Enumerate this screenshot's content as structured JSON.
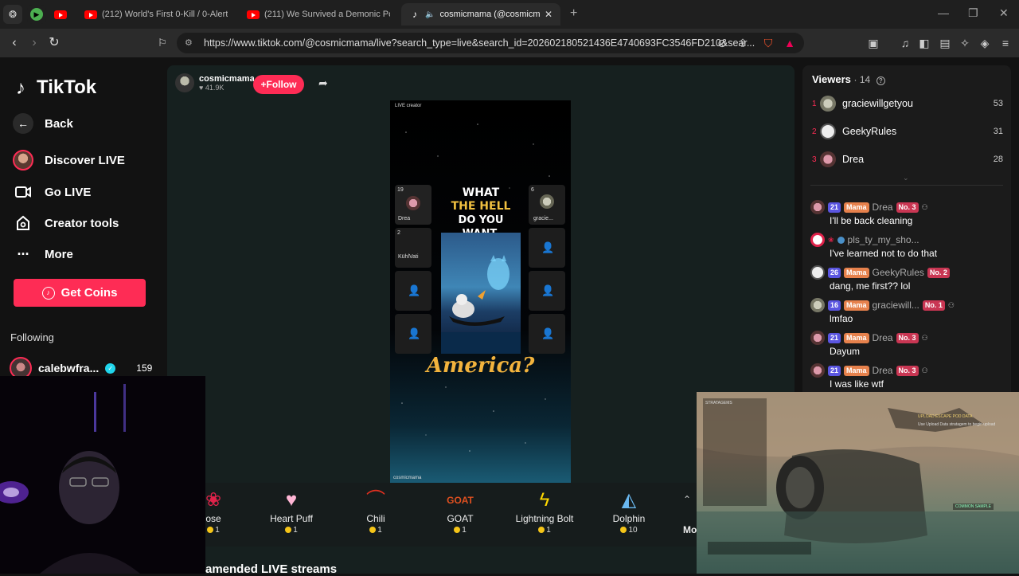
{
  "browser": {
    "tabs": [
      {
        "title": "(212) World's First 0-Kill / 0-Alert Ste"
      },
      {
        "title": "(211) We Survived a Demonic Poltergeis"
      },
      {
        "title": "cosmicmama (@cosmicmama"
      }
    ],
    "url": "https://www.tiktok.com/@cosmicmama/live?search_type=live&search_id=20260218052143​6E4740693FC3546FD210&sear..."
  },
  "sidebar": {
    "logo": "TikTok",
    "back": "Back",
    "nav": [
      {
        "label": "Discover LIVE"
      },
      {
        "label": "Go LIVE"
      },
      {
        "label": "Creator tools"
      },
      {
        "label": "More"
      }
    ],
    "get_coins": "Get Coins",
    "following_title": "Following",
    "following_user": {
      "name": "calebwfra...",
      "count": "159"
    }
  },
  "stream": {
    "host_name": "cosmicmama",
    "host_likes": "41.9K",
    "follow_label": "+Follow",
    "live_label": "LIVE creator",
    "headline": [
      "WHAT",
      "THE HELL",
      "DO YOU WANT,"
    ],
    "tagline": "America?",
    "watermark": "cosmicmama",
    "seats_left": [
      {
        "count": "19",
        "name": "Drea"
      },
      {
        "count": "2",
        "name": "KühlVati"
      }
    ],
    "seats_right": [
      {
        "count": "6",
        "name": "gracie..."
      }
    ]
  },
  "gifts": [
    {
      "name": "ose",
      "price": "1",
      "icon": "rose-icon"
    },
    {
      "name": "Heart Puff",
      "price": "1",
      "icon": "heart-puff-icon"
    },
    {
      "name": "Chili",
      "price": "1",
      "icon": "chili-icon"
    },
    {
      "name": "GOAT",
      "price": "1",
      "icon": "goat-icon"
    },
    {
      "name": "Lightning Bolt",
      "price": "1",
      "icon": "lightning-icon"
    },
    {
      "name": "Dolphin",
      "price": "10",
      "icon": "dolphin-icon"
    }
  ],
  "gifts_more": "Mo",
  "recommended": "amended LIVE streams",
  "viewers": {
    "title": "Viewers",
    "count": "· 14",
    "list": [
      {
        "rank": "1",
        "name": "graciewillgetyou",
        "score": "53"
      },
      {
        "rank": "2",
        "name": "GeekyRules",
        "score": "31"
      },
      {
        "rank": "3",
        "name": "Drea",
        "score": "28"
      }
    ]
  },
  "chat": [
    {
      "level": "21",
      "fan": "Mama",
      "name": "Drea",
      "no": "No. 3",
      "text": "I'll be back cleaning"
    },
    {
      "level": "",
      "fan": "",
      "name": "pls_ty_my_sho...",
      "no": "",
      "text": "I've learned not to do that"
    },
    {
      "level": "26",
      "fan": "Mama",
      "name": "GeekyRules",
      "no": "No. 2",
      "text": "dang, me first?? lol"
    },
    {
      "level": "16",
      "fan": "Mama",
      "name": "graciewill...",
      "no": "No. 1",
      "text": "lmfao"
    },
    {
      "level": "21",
      "fan": "Mama",
      "name": "Drea",
      "no": "No. 3",
      "text": "Dayum"
    },
    {
      "level": "21",
      "fan": "Mama",
      "name": "Drea",
      "no": "No. 3",
      "text": "I was like wtf"
    }
  ],
  "game_overlay": {
    "stratagems": "STRATAGEMS",
    "objective": "UPLOAD ESCAPE POD DATA",
    "objective_sub": "Use Upload Data stratagem to begin upload",
    "sample": "COMMON SAMPLE"
  },
  "colors": {
    "accent": "#fe2c55",
    "bg": "#121212"
  }
}
